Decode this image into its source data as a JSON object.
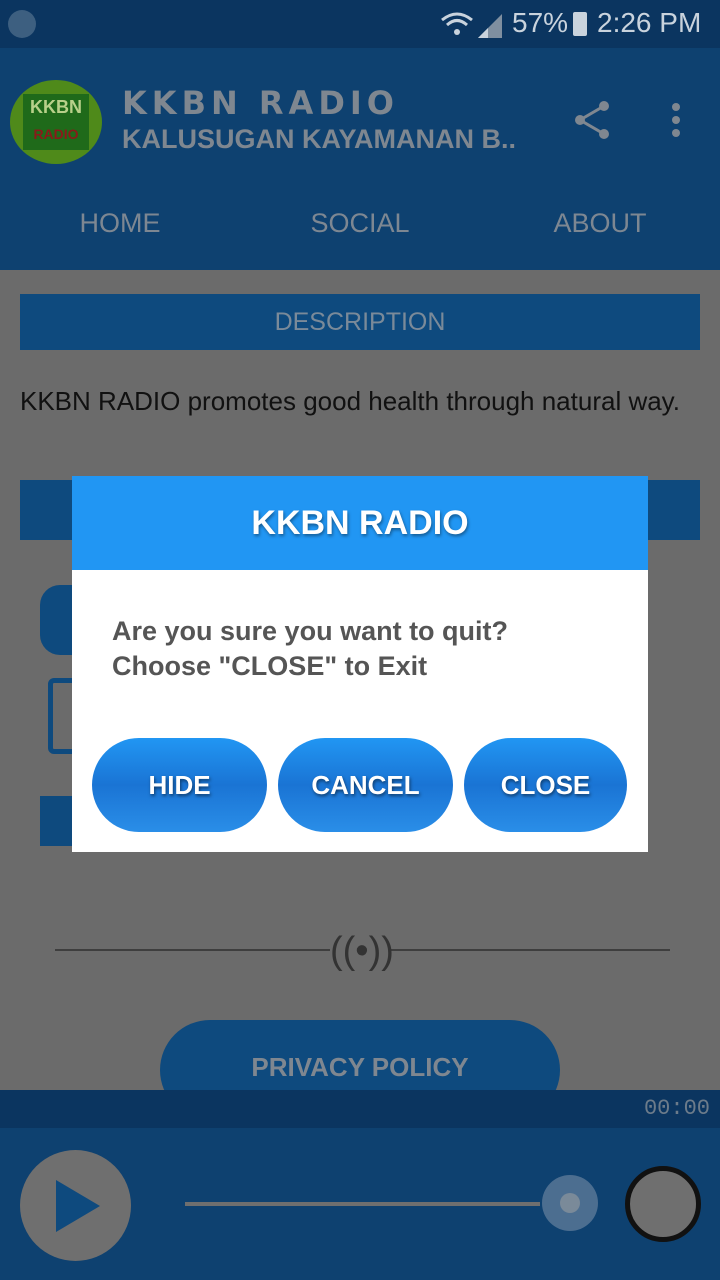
{
  "status_bar": {
    "battery": "57%",
    "time": "2:26 PM"
  },
  "header": {
    "logo_text": "KKBN RADIO",
    "title": "KKBN RADIO",
    "subtitle": "KALUSUGAN KAYAMANAN B.."
  },
  "tabs": [
    {
      "label": "HOME"
    },
    {
      "label": "SOCIAL"
    },
    {
      "label": "ABOUT"
    }
  ],
  "content": {
    "description_heading": "DESCRIPTION",
    "description_text": "KKBN RADIO promotes good health through natural way.",
    "privacy_button": "PRIVACY POLICY"
  },
  "player": {
    "timer": "00:00",
    "progress": 1.0
  },
  "dialog": {
    "title": "KKBN RADIO",
    "message_line1": "Are you sure you want to quit?",
    "message_line2": "Choose \"CLOSE\" to Exit",
    "buttons": [
      "HIDE",
      "CANCEL",
      "CLOSE"
    ]
  },
  "colors": {
    "dialog_accent": "#2196f3",
    "header": "#0e4170"
  }
}
